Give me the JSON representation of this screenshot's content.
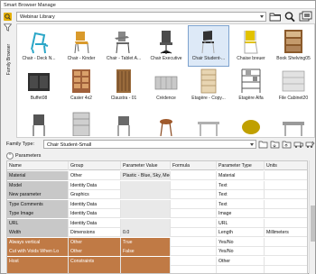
{
  "window": {
    "title": "Smart Browser Manage"
  },
  "sidebar": {
    "vertical_tab": "Family Browser"
  },
  "toolbar": {
    "library_value": "Webinar Library",
    "icons": [
      "folder-icon",
      "search-icon",
      "collection-icon"
    ]
  },
  "gallery": {
    "rows": [
      [
        {
          "label": "Chair - Deck N...",
          "icon": "deck-chair-icon",
          "color": "#2aa6c7"
        },
        {
          "label": "Chair - Kinder",
          "icon": "kinder-chair-icon",
          "color": "#d99a2b"
        },
        {
          "label": "Chair - Tablet A...",
          "icon": "tablet-chair-icon",
          "color": "#6d6d6d"
        },
        {
          "label": "Chair Executive",
          "icon": "executive-chair-icon",
          "color": "#5a5a5a"
        },
        {
          "label": "Chair Student-...",
          "icon": "student-chair-icon",
          "color": "#333333"
        },
        {
          "label": "Chaise breuer",
          "icon": "breuer-chair-icon",
          "color": "#e2c200"
        },
        {
          "label": "Book Shelving05",
          "icon": "bookshelf-icon",
          "color": "#8b5a2b"
        }
      ],
      [
        {
          "label": "Buffet08",
          "icon": "buffet-icon",
          "color": "#3a3a3a"
        },
        {
          "label": "Casier 4x2",
          "icon": "casier-icon",
          "color": "#a0603a"
        },
        {
          "label": "Claustra - 01",
          "icon": "claustra-icon",
          "color": "#9a6b3c"
        },
        {
          "label": "Crédence",
          "icon": "credence-icon",
          "color": "#b0b0b0"
        },
        {
          "label": "Etagère - Copy...",
          "icon": "etagere-icon",
          "color": "#c8a06a"
        },
        {
          "label": "Etagère Alfa",
          "icon": "etagere-alfa-icon",
          "color": "#7a7a7a"
        },
        {
          "label": "File Cabinet20",
          "icon": "file-cabinet-icon",
          "color": "#cfcfcf"
        }
      ],
      [
        {
          "label": "",
          "icon": "chair-partial-icon",
          "color": "#555555"
        },
        {
          "label": "",
          "icon": "shelf-partial-icon",
          "color": "#8c8c8c"
        },
        {
          "label": "",
          "icon": "chair-partial-icon",
          "color": "#6a6a6a"
        },
        {
          "label": "",
          "icon": "stool-partial-icon",
          "color": "#a05a2c"
        },
        {
          "label": "",
          "icon": "table-partial-icon",
          "color": "#b0b0b0"
        },
        {
          "label": "",
          "icon": "blob-partial-icon",
          "color": "#c0a000"
        },
        {
          "label": "",
          "icon": "table-partial-icon",
          "color": "#9a9a9a"
        }
      ]
    ],
    "selected_index": 4
  },
  "family_type": {
    "label": "Family Type:",
    "value": "Chair Student-Small"
  },
  "parameters": {
    "header": "Parameters",
    "columns": [
      "Name",
      "Group",
      "Parameter Value",
      "Formula",
      "Parameter Type",
      "Units"
    ],
    "rows": [
      {
        "name": "Material",
        "group": "Other",
        "value": "Plastic - Blue, Sky, Medi",
        "formula": "",
        "type": "Material",
        "units": "",
        "style": "gray"
      },
      {
        "name": "Model",
        "group": "Identity Data",
        "value": "",
        "formula": "",
        "type": "Text",
        "units": "",
        "style": "gray"
      },
      {
        "name": "New parameter",
        "group": "Graphics",
        "value": "",
        "formula": "",
        "type": "Text",
        "units": "",
        "style": "gray"
      },
      {
        "name": "Type Comments",
        "group": "Identity Data",
        "value": "",
        "formula": "",
        "type": "Text",
        "units": "",
        "style": "gray"
      },
      {
        "name": "Type Image",
        "group": "Identity Data",
        "value": "",
        "formula": "",
        "type": "Image",
        "units": "",
        "style": "gray"
      },
      {
        "name": "URL",
        "group": "Identity Data",
        "value": "",
        "formula": "",
        "type": "URL",
        "units": "",
        "style": "gray"
      },
      {
        "name": "Width",
        "group": "Dimensions",
        "value": "0.0",
        "formula": "",
        "type": "Length",
        "units": "Millimeters",
        "style": "gray"
      },
      {
        "name": "Always vertical",
        "group": "Other",
        "value": "True",
        "formula": "",
        "type": "Yes/No",
        "units": "",
        "style": "orange"
      },
      {
        "name": "Cut with Voids When Lo",
        "group": "Other",
        "value": "False",
        "formula": "",
        "type": "Yes/No",
        "units": "",
        "style": "orange"
      },
      {
        "name": "Host",
        "group": "Constraints",
        "value": "",
        "formula": "",
        "type": "Other",
        "units": "",
        "style": "orange"
      },
      {
        "name": "",
        "group": "",
        "value": "",
        "formula": "",
        "type": "",
        "units": "",
        "style": "orange"
      }
    ]
  }
}
